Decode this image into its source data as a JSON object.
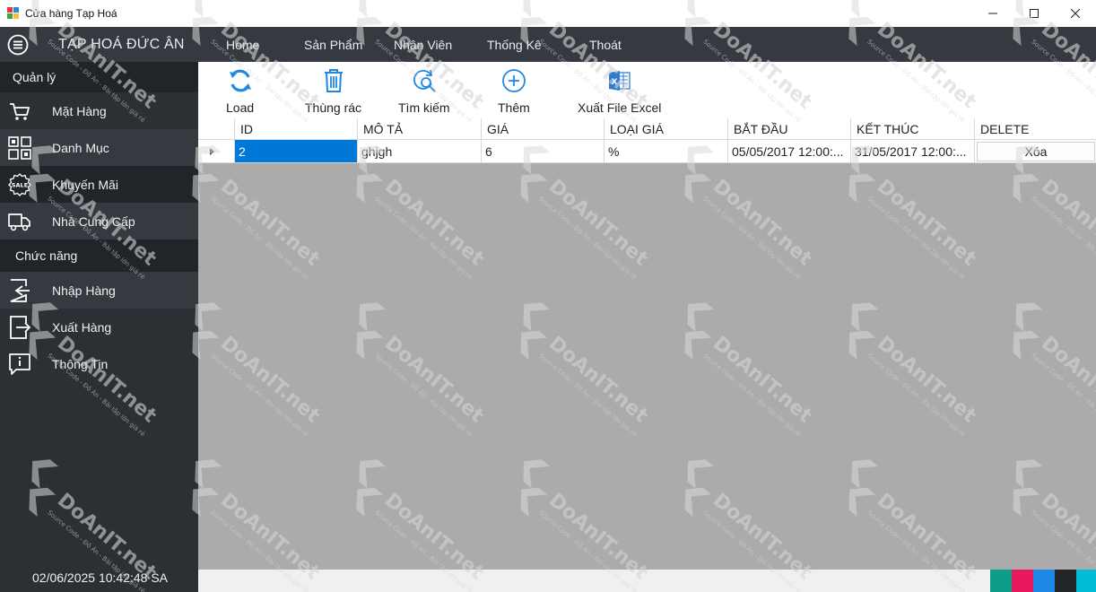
{
  "window": {
    "title": "Cửa hàng Tạp Hoá",
    "minimize": "—",
    "maximize": "☐",
    "close": "✕"
  },
  "topnav": {
    "brand": "TẠP HOÁ ĐỨC ÂN",
    "items": [
      "Home",
      "Sản Phẩm",
      "Nhân Viên",
      "Thống Kê",
      "Thoát"
    ]
  },
  "sidebar": {
    "section1": "Quản lý",
    "items1": [
      {
        "label": "Mặt Hàng",
        "icon": "cart-icon"
      },
      {
        "label": "Danh Mục",
        "icon": "grid-icon"
      },
      {
        "label": "Khuyến Mãi",
        "icon": "sale-icon"
      },
      {
        "label": "Nhà Cung Cấp",
        "icon": "truck-icon"
      }
    ],
    "section2": "Chức năng",
    "items2": [
      {
        "label": "Nhập Hàng",
        "icon": "sign-in-icon"
      },
      {
        "label": "Xuất Hàng",
        "icon": "sign-out-icon"
      },
      {
        "label": "Thông Tin",
        "icon": "info-icon"
      }
    ],
    "clock": "02/06/2025 10:42:48 SA"
  },
  "toolbar": {
    "load": "Load",
    "trash": "Thùng rác",
    "search": "Tìm kiếm",
    "add": "Thêm",
    "export": "Xuất File Excel"
  },
  "grid": {
    "columns": [
      "ID",
      "MÔ TẢ",
      "GIÁ",
      "LOẠI GIÁ",
      "BẮT ĐẦU",
      "KẾT THÚC",
      "DELETE"
    ],
    "rows": [
      {
        "id": "2",
        "mota": "ghjgh",
        "gia": "6",
        "loaigia": "%",
        "batdau": "05/05/2017 12:00:...",
        "ketthuc": "31/05/2017 12:00:...",
        "delete": "Xóa"
      }
    ]
  },
  "watermark": {
    "brand": "DoAnIT.net",
    "tagline": "Source Code - Đồ Án - Bài tập lớn giá rẻ"
  },
  "colors": {
    "nav_bg": "#343a40",
    "sidebar_bg": "#2b3035",
    "selection": "#0078d7",
    "swatches": [
      "#0f9d89",
      "#e8185f",
      "#1e88e5",
      "#212529",
      "#00bcd4"
    ]
  }
}
